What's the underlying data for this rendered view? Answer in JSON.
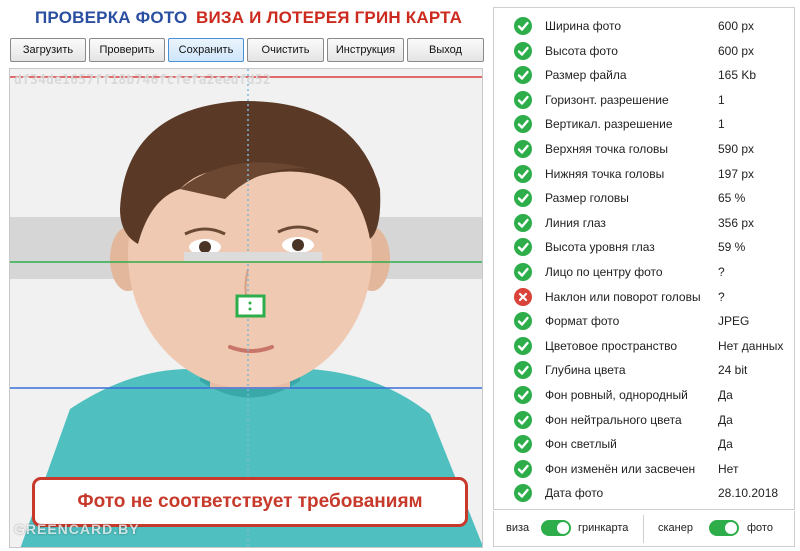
{
  "header": {
    "title_left": "ПРОВЕРКА ФОТО",
    "title_right": "ВИЗА И ЛОТЕРЕЯ ГРИН КАРТА"
  },
  "toolbar": {
    "buttons": [
      {
        "label": "Загрузить"
      },
      {
        "label": "Проверить"
      },
      {
        "label": "Сохранить",
        "active": true
      },
      {
        "label": "Очистить"
      },
      {
        "label": "Инструкция"
      },
      {
        "label": "Выход"
      }
    ]
  },
  "photo": {
    "hash": "df34de1657ff18b746fcfefa2eedfd52",
    "verdict": "Фото не соответствует требованиям",
    "watermark": "GREENCARD.BY",
    "colors": {
      "verdict": "#c73a2b",
      "top_line": "#d94040",
      "eye_line": "#2eae4a",
      "chin_line": "#3a6fd8",
      "center_line": "#7fb7d9"
    }
  },
  "checks": [
    {
      "label": "Ширина фото",
      "value": "600 px",
      "status": "ok"
    },
    {
      "label": "Высота фото",
      "value": "600 px",
      "status": "ok"
    },
    {
      "label": "Размер файла",
      "value": "165 Kb",
      "status": "ok"
    },
    {
      "label": "Горизонт. разрешение",
      "value": "1",
      "status": "ok"
    },
    {
      "label": "Вертикал. разрешение",
      "value": "1",
      "status": "ok"
    },
    {
      "label": "Верхняя точка головы",
      "value": "590 px",
      "status": "ok"
    },
    {
      "label": "Нижняя точка головы",
      "value": "197 px",
      "status": "ok"
    },
    {
      "label": "Размер головы",
      "value": "65 %",
      "status": "ok"
    },
    {
      "label": "Линия глаз",
      "value": "356 px",
      "status": "ok"
    },
    {
      "label": "Высота уровня глаз",
      "value": "59 %",
      "status": "ok"
    },
    {
      "label": "Лицо по центру фото",
      "value": "?",
      "status": "ok"
    },
    {
      "label": "Наклон или поворот головы",
      "value": "?",
      "status": "fail"
    },
    {
      "label": "Формат фото",
      "value": "JPEG",
      "status": "ok"
    },
    {
      "label": "Цветовое пространство",
      "value": "Нет данных",
      "status": "ok"
    },
    {
      "label": "Глубина цвета",
      "value": "24 bit",
      "status": "ok"
    },
    {
      "label": "Фон ровный, однородный",
      "value": "Да",
      "status": "ok"
    },
    {
      "label": "Фон нейтрального цвета",
      "value": "Да",
      "status": "ok"
    },
    {
      "label": "Фон светлый",
      "value": "Да",
      "status": "ok"
    },
    {
      "label": "Фон изменён или засвечен",
      "value": "Нет",
      "status": "ok"
    },
    {
      "label": "Дата фото",
      "value": "28.10.2018",
      "status": "ok"
    }
  ],
  "status_colors": {
    "ok": "#2eae4a",
    "fail": "#d9433a"
  },
  "icons": {
    "ok": "check-circle-icon",
    "fail": "cross-circle-icon"
  },
  "footer": {
    "toggle1": {
      "left": "виза",
      "right": "гринкарта",
      "on": true
    },
    "toggle2": {
      "left": "сканер",
      "right": "фото",
      "on": true
    },
    "toggle_color": "#2eae4a"
  }
}
